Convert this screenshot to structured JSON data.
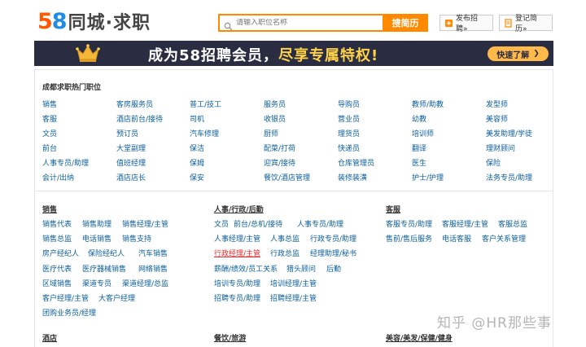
{
  "header": {
    "logo_num_a": "5",
    "logo_num_b": "8",
    "logo_text": "同城·求职",
    "search_placeholder": "请输入职位名称",
    "search_button": "搜简历",
    "post_button": "发布招聘»",
    "register_button": "登记简历»"
  },
  "banner": {
    "text_main": "成为58招聘会员，",
    "text_highlight": "尽享专属特权!",
    "cta": "快速了解",
    "cta_arrow": "❯"
  },
  "hot": {
    "title": "成都求职热门职位",
    "columns": [
      [
        "销售",
        "客服",
        "文员",
        "前台",
        "人事专员/助理",
        "会计/出纳"
      ],
      [
        "客房服务员",
        "酒店前台/接待",
        "预订员",
        "大堂副理",
        "值班经理",
        "酒店店长"
      ],
      [
        "普工/技工",
        "司机",
        "汽车修理",
        "保洁",
        "保姆",
        "保安"
      ],
      [
        "服务员",
        "收银员",
        "厨师",
        "配菜/打荷",
        "迎宾/接待",
        "餐饮/酒店管理"
      ],
      [
        "导购员",
        "营业员",
        "理货员",
        "快递员",
        "仓库管理员",
        "装修装潢"
      ],
      [
        "教师/助教",
        "幼教",
        "培训师",
        "翻译",
        "医生",
        "护士/护理"
      ],
      [
        "发型师",
        "美容师",
        "美发助理/学徒",
        "理财顾问",
        "保险",
        "法务专员/助理"
      ]
    ]
  },
  "categories": [
    {
      "title": "销售",
      "rows": [
        [
          "销售代表",
          "销售助理",
          "销售经理/主管"
        ],
        [
          "销售总监",
          "电话销售",
          "销售支持"
        ],
        [
          "房产经纪人",
          "保险经纪人",
          "汽车销售"
        ],
        [
          "医疗代表",
          "医疗器械销售",
          "网络销售"
        ],
        [
          "区域销售",
          "渠道专员",
          "渠道经理/总监"
        ],
        [
          "客户经理/主管",
          "大客户经理"
        ],
        [
          "团购业务员/经理"
        ]
      ]
    },
    {
      "title": "人事/行政/后勤",
      "rows": [
        [
          "文员",
          "前台/总机/接待",
          "人事专员/助理"
        ],
        [
          "人事经理/主管",
          "人事总监",
          "行政专员/助理"
        ],
        [
          "行政经理/主管",
          "行政总监",
          "经理助理/秘书"
        ],
        [
          "薪酬/绩效/员工关系",
          "猎头顾问",
          "后勤"
        ],
        [
          "培训专员/助理",
          "培训经理/主管"
        ],
        [
          "招聘专员/助理",
          "招聘经理/主管"
        ]
      ]
    },
    {
      "title": "客服",
      "rows": [
        [
          "客服专员/助理",
          "客服经理/主管",
          "客服总监"
        ],
        [
          "售前/售后服务",
          "电话客服",
          "客户关系管理"
        ]
      ]
    }
  ],
  "bottom_heads": [
    "酒店",
    "餐饮/旅游",
    "美容/美发/保健/健身"
  ],
  "watermark": "知乎 @HR那些事",
  "colors": {
    "accent": "#ff8a00",
    "link": "#0a5d9b",
    "banner_bg": "#2a2d42",
    "banner_highlight": "#ffd24a",
    "selected_link": "#e8292b"
  }
}
